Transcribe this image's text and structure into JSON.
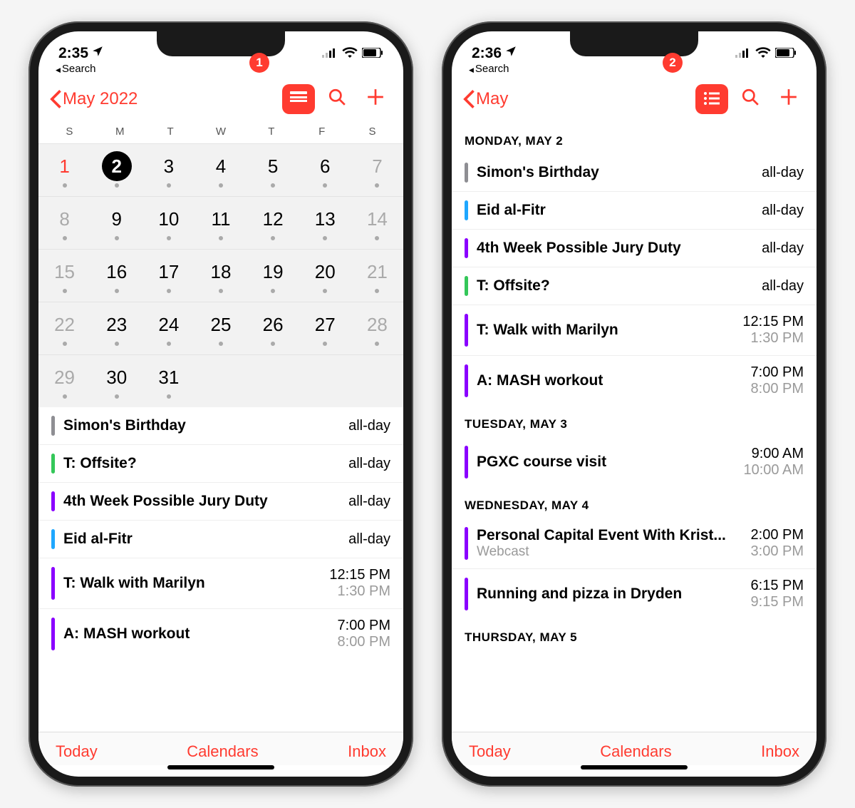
{
  "phones": [
    {
      "status_time": "2:35",
      "back_app": "Search",
      "badge": "1",
      "nav_title": "May 2022",
      "dow": [
        "S",
        "M",
        "T",
        "W",
        "T",
        "F",
        "S"
      ],
      "cal": [
        {
          "n": 1,
          "dim": false,
          "red": true,
          "dot": true
        },
        {
          "n": 2,
          "sel": true,
          "dot": true
        },
        {
          "n": 3,
          "dot": true
        },
        {
          "n": 4,
          "dot": true
        },
        {
          "n": 5,
          "dot": true
        },
        {
          "n": 6,
          "dot": true
        },
        {
          "n": 7,
          "dim": true,
          "dot": true
        },
        {
          "n": 8,
          "dim": true,
          "dot": true
        },
        {
          "n": 9,
          "dot": true
        },
        {
          "n": 10,
          "dot": true
        },
        {
          "n": 11,
          "dot": true
        },
        {
          "n": 12,
          "dot": true
        },
        {
          "n": 13,
          "dot": true
        },
        {
          "n": 14,
          "dim": true,
          "dot": true
        },
        {
          "n": 15,
          "dim": true,
          "dot": true
        },
        {
          "n": 16,
          "dot": true
        },
        {
          "n": 17,
          "dot": true
        },
        {
          "n": 18,
          "dot": true
        },
        {
          "n": 19,
          "dot": true
        },
        {
          "n": 20,
          "dot": true
        },
        {
          "n": 21,
          "dim": true,
          "dot": true
        },
        {
          "n": 22,
          "dim": true,
          "dot": true
        },
        {
          "n": 23,
          "dot": true
        },
        {
          "n": 24,
          "dot": true
        },
        {
          "n": 25,
          "dot": true
        },
        {
          "n": 26,
          "dot": true
        },
        {
          "n": 27,
          "dot": true
        },
        {
          "n": 28,
          "dim": true,
          "dot": true
        },
        {
          "n": 29,
          "dim": true,
          "dot": true
        },
        {
          "n": 30,
          "dot": true
        },
        {
          "n": 31,
          "dot": true
        },
        {
          "n": "",
          "dot": false
        },
        {
          "n": "",
          "dot": false
        },
        {
          "n": "",
          "dot": false
        },
        {
          "n": "",
          "dot": false
        }
      ],
      "events": [
        {
          "color": "#8e8e93",
          "title": "Simon's Birthday",
          "time1": "all-day"
        },
        {
          "color": "#34c759",
          "title": "T: Offsite?",
          "time1": "all-day"
        },
        {
          "color": "#8a00ff",
          "title": "4th Week Possible Jury Duty",
          "time1": "all-day"
        },
        {
          "color": "#1ea7ff",
          "title": "Eid al-Fitr",
          "time1": "all-day"
        },
        {
          "color": "#8a00ff",
          "title": "T: Walk with Marilyn",
          "time1": "12:15 PM",
          "time2": "1:30 PM"
        },
        {
          "color": "#8a00ff",
          "title": "A: MASH workout",
          "time1": "7:00 PM",
          "time2": "8:00 PM"
        }
      ],
      "toolbar": {
        "today": "Today",
        "cal": "Calendars",
        "inbox": "Inbox"
      }
    },
    {
      "status_time": "2:36",
      "back_app": "Search",
      "badge": "2",
      "nav_title": "May",
      "sections": [
        {
          "header": "MONDAY, MAY 2",
          "events": [
            {
              "color": "#8e8e93",
              "title": "Simon's Birthday",
              "time1": "all-day"
            },
            {
              "color": "#1ea7ff",
              "title": "Eid al-Fitr",
              "time1": "all-day"
            },
            {
              "color": "#8a00ff",
              "title": "4th Week Possible Jury Duty",
              "time1": "all-day"
            },
            {
              "color": "#34c759",
              "title": "T: Offsite?",
              "time1": "all-day"
            },
            {
              "color": "#8a00ff",
              "title": "T: Walk with Marilyn",
              "time1": "12:15 PM",
              "time2": "1:30 PM"
            },
            {
              "color": "#8a00ff",
              "title": "A: MASH workout",
              "time1": "7:00 PM",
              "time2": "8:00 PM"
            }
          ]
        },
        {
          "header": "TUESDAY, MAY 3",
          "events": [
            {
              "color": "#8a00ff",
              "title": "PGXC course visit",
              "time1": "9:00 AM",
              "time2": "10:00 AM"
            }
          ]
        },
        {
          "header": "WEDNESDAY, MAY 4",
          "events": [
            {
              "color": "#8a00ff",
              "title": "Personal Capital Event With Krist...",
              "sub": "Webcast",
              "time1": "2:00 PM",
              "time2": "3:00 PM"
            },
            {
              "color": "#8a00ff",
              "title": "Running and pizza in Dryden",
              "time1": "6:15 PM",
              "time2": "9:15 PM"
            }
          ]
        },
        {
          "header": "THURSDAY, MAY 5",
          "events": []
        }
      ],
      "toolbar": {
        "today": "Today",
        "cal": "Calendars",
        "inbox": "Inbox"
      }
    }
  ]
}
